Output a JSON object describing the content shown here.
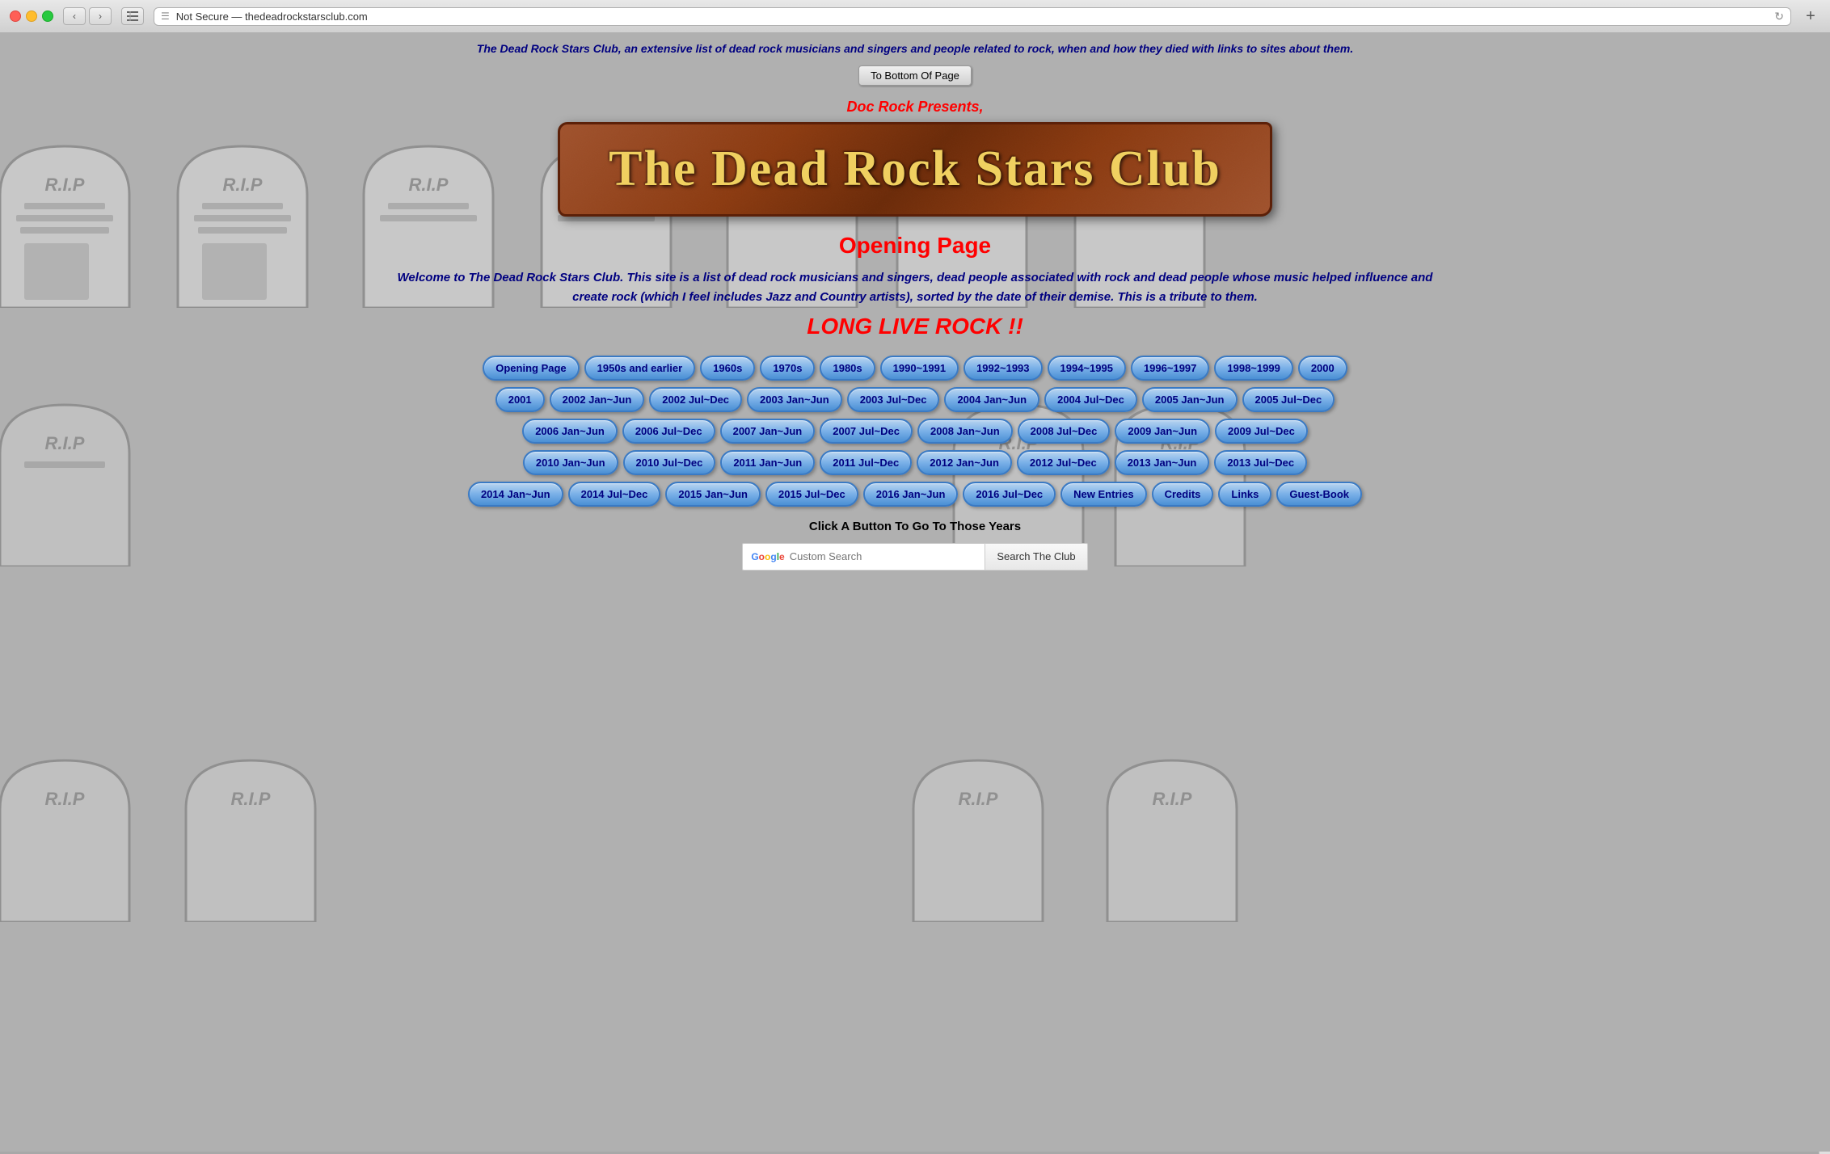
{
  "browser": {
    "url": "Not Secure — thedeadrockstarsclub.com",
    "new_tab_label": "+"
  },
  "page": {
    "description": "The Dead Rock Stars Club, an extensive list of dead rock musicians and singers and people related to rock, when and how they died with links to sites about them.",
    "to_bottom_btn": "To Bottom Of Page",
    "doc_rock": "Doc Rock Presents,",
    "title": "The Dead Rock Stars Club",
    "opening_page": "Opening Page",
    "welcome": "Welcome to The Dead Rock Stars Club. This site is a list of dead rock musicians and singers, dead people associated with rock and dead people whose music helped influence and create rock (which I feel includes Jazz and Country artists), sorted by the date of their demise. This is a tribute to them.",
    "long_live": "LONG LIVE ROCK !!",
    "click_instruction": "Click A Button To Go To Those Years",
    "search_placeholder": "Custom Search",
    "search_btn": "Search The Club",
    "google_label": "Google Custom Search"
  },
  "nav_buttons": [
    "Opening Page",
    "1950s and earlier",
    "1960s",
    "1970s",
    "1980s",
    "1990~1991",
    "1992~1993",
    "1994~1995",
    "1996~1997",
    "1998~1999",
    "2000",
    "2001",
    "2002 Jan~Jun",
    "2002 Jul~Dec",
    "2003 Jan~Jun",
    "2003 Jul~Dec",
    "2004 Jan~Jun",
    "2004 Jul~Dec",
    "2005 Jan~Jun",
    "2005 Jul~Dec",
    "2006 Jan~Jun",
    "2006 Jul~Dec",
    "2007 Jan~Jun",
    "2007 Jul~Dec",
    "2008 Jan~Jun",
    "2008 Jul~Dec",
    "2009 Jan~Jun",
    "2009 Jul~Dec",
    "2010 Jan~Jun",
    "2010 Jul~Dec",
    "2011 Jan~Jun",
    "2011 Jul~Dec",
    "2012 Jan~Jun",
    "2012 Jul~Dec",
    "2013 Jan~Jun",
    "2013 Jul~Dec",
    "2014 Jan~Jun",
    "2014 Jul~Dec",
    "2015 Jan~Jun",
    "2015 Jul~Dec",
    "2016 Jan~Jun",
    "2016 Jul~Dec",
    "New Entries",
    "Credits",
    "Links",
    "Guest-Book"
  ]
}
